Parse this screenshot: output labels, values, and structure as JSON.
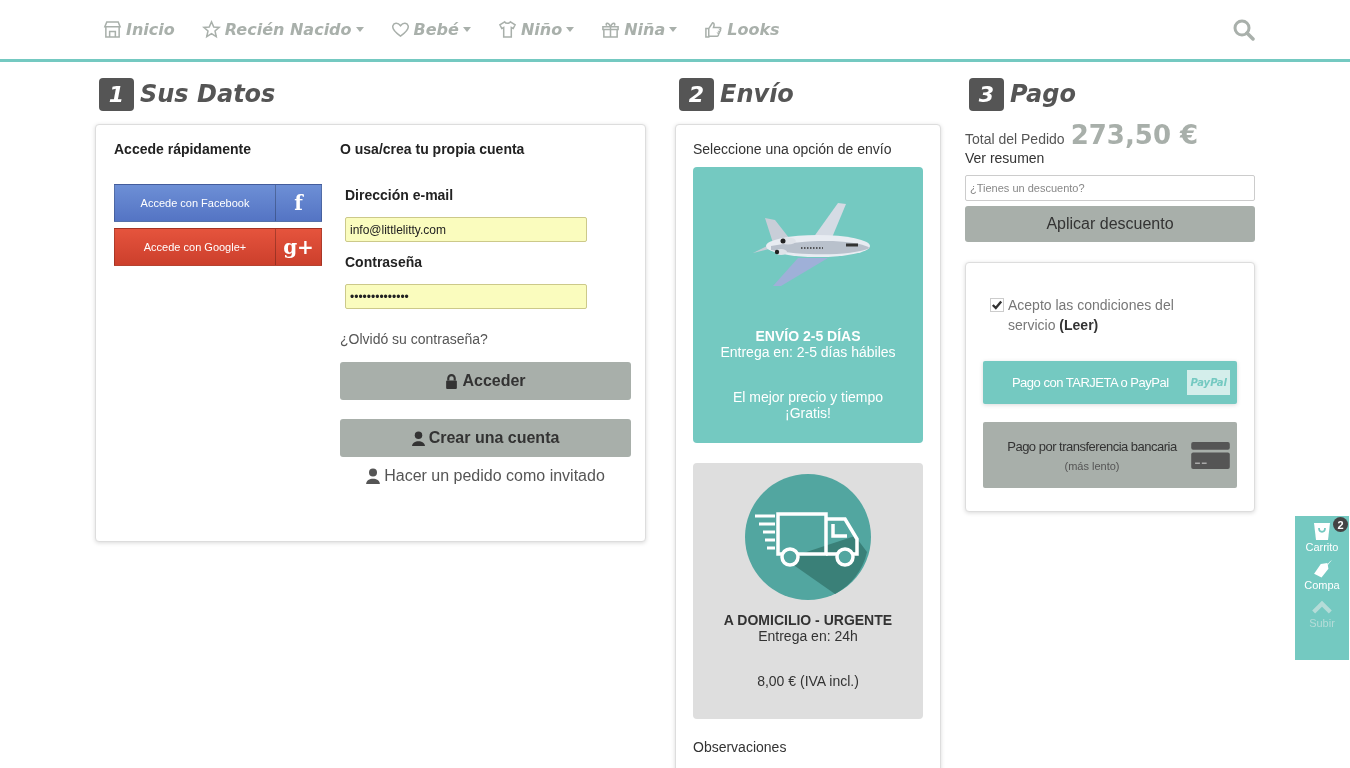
{
  "nav": {
    "items": [
      {
        "label": "Inicio",
        "dropdown": false
      },
      {
        "label": "Recién Nacido",
        "dropdown": true
      },
      {
        "label": "Bebé",
        "dropdown": true
      },
      {
        "label": "Niño",
        "dropdown": true
      },
      {
        "label": "Niña",
        "dropdown": true
      },
      {
        "label": "Looks",
        "dropdown": false
      }
    ]
  },
  "steps": [
    {
      "number": "1",
      "title": "Sus Datos"
    },
    {
      "number": "2",
      "title": "Envío"
    },
    {
      "number": "3",
      "title": "Pago"
    }
  ],
  "account": {
    "quick_title": "Accede rápidamente",
    "own_title": "O usa/crea tu propia cuenta",
    "social": [
      {
        "kind": "facebook",
        "label": "Accede con Facebook",
        "glyph": "f"
      },
      {
        "kind": "google",
        "label": "Accede con Google+",
        "glyph": "g+"
      }
    ],
    "email_label": "Dirección e-mail",
    "email_value": "info@littlelitty.com",
    "password_label": "Contraseña",
    "password_value": "••••••••••••••",
    "forgot": "¿Olvidó su contraseña?",
    "login_button": "Acceder",
    "create_button": "Crear una cuenta",
    "guest": "Hacer un pedido como invitado"
  },
  "shipping": {
    "prompt": "Seleccione una opción de envío",
    "options": [
      {
        "kind": "plane",
        "selected": true,
        "title": "ENVÍO 2-5 DÍAS",
        "delivery": "Entrega en:  2-5 días hábiles",
        "price_lines": [
          "El mejor precio y tiempo",
          "¡Gratis!"
        ]
      },
      {
        "kind": "truck",
        "selected": false,
        "title": "A DOMICILIO - URGENTE",
        "delivery": "Entrega en:  24h",
        "price_lines": [
          "8,00 € (IVA incl.)"
        ]
      }
    ],
    "notes_label": "Observaciones"
  },
  "payment": {
    "total_label": "Total del Pedido",
    "total": "273,50 €",
    "summary_link": "Ver resumen",
    "discount_placeholder": "¿Tienes un descuento?",
    "discount_button": "Aplicar descuento",
    "terms": {
      "checked": true,
      "text": "Acepto las condiciones del servicio **(Leer)**"
    },
    "methods": [
      {
        "kind": "card",
        "label": "Pago con TARJETA o PayPal",
        "badge": "PayPal"
      },
      {
        "kind": "transfer",
        "label": "Pago por transferencia bancaria",
        "note": "(más lento)"
      }
    ]
  },
  "side_widget": [
    {
      "kind": "cart",
      "label": "Carrito",
      "count": "2",
      "disabled": false
    },
    {
      "kind": "tag",
      "label": "Compa",
      "disabled": false
    },
    {
      "kind": "up",
      "label": "Subir",
      "disabled": true
    }
  ]
}
